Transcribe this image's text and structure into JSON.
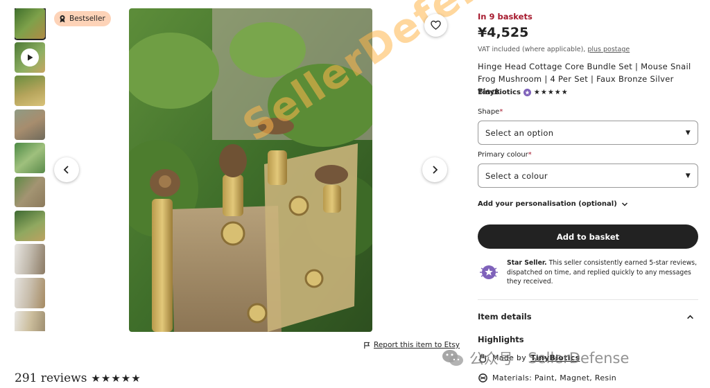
{
  "gallery": {
    "badge_label": "Bestseller",
    "thumbnail_count": 10,
    "report_label": "Report this item to Etsy",
    "reviews_label": "291 reviews",
    "reviews_stars": "★★★★★"
  },
  "listing": {
    "baskets": "In 9 baskets",
    "price": "¥4,525",
    "vat_text": "VAT included (where applicable),",
    "vat_link": "plus postage",
    "title": "Hinge Head Cottage Core Bundle Set | Mouse Snail Frog Mushroom | 4 Per Set | Faux Bronze Silver Black",
    "shop_name": "TinyBiotics",
    "shop_stars": "★★★★★"
  },
  "options": {
    "shape_label": "Shape",
    "shape_placeholder": "Select an option",
    "colour_label": "Primary colour",
    "colour_placeholder": "Select a colour",
    "required_mark": "*",
    "personalisation_label": "Add your personalisation (optional)"
  },
  "actions": {
    "add_to_basket": "Add to basket"
  },
  "star_seller": {
    "title": "Star Seller.",
    "text": "This seller consistently earned 5-star reviews, dispatched on time, and replied quickly to any messages they received."
  },
  "details": {
    "item_details_label": "Item details",
    "highlights_label": "Highlights",
    "made_by_prefix": "Made by",
    "made_by_shop": "TinyBiotics",
    "materials": "Materials: Paint, Magnet, Resin"
  },
  "watermarks": {
    "diagonal": "SellerDefense",
    "wechat_cn": "公众号 ·",
    "wechat_name": "SellerDefense"
  },
  "colors": {
    "accent_red": "#a61a2e",
    "button_dark": "#222222",
    "badge_bg": "#fdd3b8",
    "star_seller_purple": "#7f62ba"
  }
}
